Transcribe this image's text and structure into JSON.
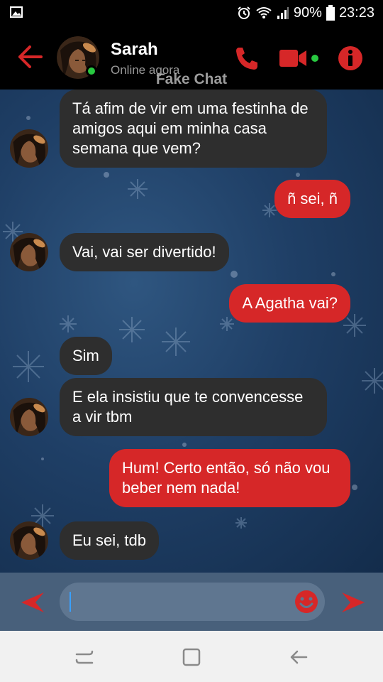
{
  "status_bar": {
    "battery": "90%",
    "time": "23:23"
  },
  "header": {
    "name": "Sarah",
    "status": "Online agora"
  },
  "watermark": "Fake Chat",
  "messages": [
    {
      "side": "in",
      "text": "Tá afim de vir em uma festinha de amigos aqui em minha casa semana que vem?"
    },
    {
      "side": "out",
      "text": "ñ sei, ñ"
    },
    {
      "side": "in",
      "text": "Vai, vai ser divertido!"
    },
    {
      "side": "out",
      "text": "A Agatha vai?"
    },
    {
      "side": "in",
      "text": "Sim"
    },
    {
      "side": "in",
      "text": "E ela insistiu que te convencesse a vir tbm"
    },
    {
      "side": "out",
      "text": "Hum! Certo então, só não vou beber nem nada!"
    },
    {
      "side": "in",
      "text": "Eu sei, tdb"
    }
  ],
  "input": {
    "value": ""
  },
  "colors": {
    "accent": "#d62728",
    "incoming": "#2e2e2e",
    "online": "#28c940"
  },
  "icons": [
    "back-arrow-icon",
    "phone-icon",
    "video-camera-icon",
    "info-icon",
    "emoji-icon",
    "send-icon",
    "prev-icon"
  ]
}
